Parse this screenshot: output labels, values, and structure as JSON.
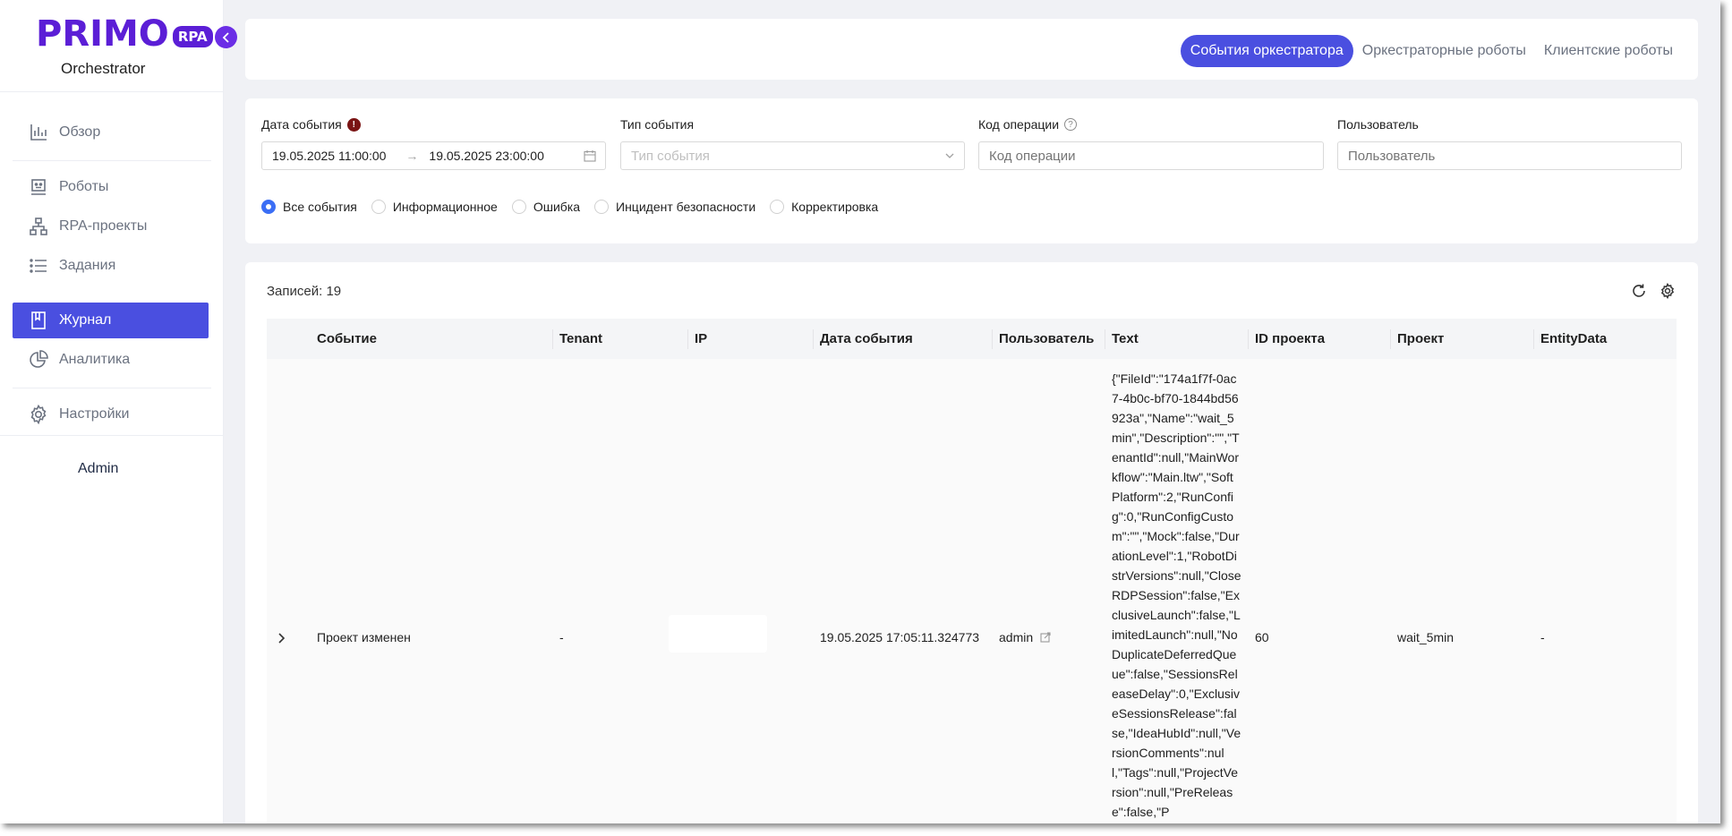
{
  "app": {
    "logo_main": "PRIMO",
    "logo_badge": "RPA",
    "subtitle": "Orchestrator"
  },
  "sidebar": {
    "items": [
      {
        "label": "Обзор",
        "icon": "bar-chart-icon"
      },
      {
        "label": "Роботы",
        "icon": "robot-icon"
      },
      {
        "label": "RPA-проекты",
        "icon": "hierarchy-icon"
      },
      {
        "label": "Задания",
        "icon": "list-icon"
      },
      {
        "label": "Журнал",
        "icon": "book-icon",
        "active": true
      },
      {
        "label": "Аналитика",
        "icon": "pie-chart-icon"
      },
      {
        "label": "Настройки",
        "icon": "gear-icon"
      }
    ],
    "user": "Admin"
  },
  "tabs": [
    {
      "label": "События оркестратора",
      "active": true
    },
    {
      "label": "Оркестраторные роботы"
    },
    {
      "label": "Клиентские роботы"
    }
  ],
  "filters": {
    "date_label": "Дата события",
    "date_from": "19.05.2025 11:00:00",
    "date_to": "19.05.2025 23:00:00",
    "event_type_label": "Тип события",
    "event_type_placeholder": "Тип события",
    "op_code_label": "Код операции",
    "op_code_placeholder": "Код операции",
    "user_label": "Пользователь",
    "user_placeholder": "Пользователь",
    "radios": [
      {
        "label": "Все события",
        "checked": true
      },
      {
        "label": "Информационное"
      },
      {
        "label": "Ошибка"
      },
      {
        "label": "Инцидент безопасности"
      },
      {
        "label": "Корректировка"
      }
    ]
  },
  "table": {
    "records": "Записей: 19",
    "columns": [
      "Событие",
      "Tenant",
      "IP",
      "Дата события",
      "Пользователь",
      "Text",
      "ID проекта",
      "Проект",
      "EntityData"
    ],
    "rows": [
      {
        "event": "Проект изменен",
        "tenant": "-",
        "ip": "",
        "date": "19.05.2025 17:05:11.324773",
        "user": "admin",
        "text": "{\"FileId\":\"174a1f7f-0ac7-4b0c-bf70-1844bd56923a\",\"Name\":\"wait_5min\",\"Description\":\"\",\"TenantId\":null,\"MainWorkflow\":\"Main.ltw\",\"SoftPlatform\":2,\"RunConfig\":0,\"RunConfigCustom\":\"\",\"Mock\":false,\"DurationLevel\":1,\"RobotDistrVersions\":null,\"CloseRDPSession\":false,\"ExclusiveLaunch\":false,\"LimitedLaunch\":null,\"NoDuplicateDeferredQueue\":false,\"SessionsReleaseDelay\":0,\"ExclusiveSessionsRelease\":false,\"IdeaHubId\":null,\"VersionComments\":null,\"Tags\":null,\"ProjectVersion\":null,\"PreRelease\":false,\"P",
        "project_id": "60",
        "project": "wait_5min",
        "entity_data": "-"
      }
    ]
  },
  "colors": {
    "accent": "#4a4fe0",
    "brand": "#5b1ed6",
    "radio": "#3b6ef5"
  }
}
